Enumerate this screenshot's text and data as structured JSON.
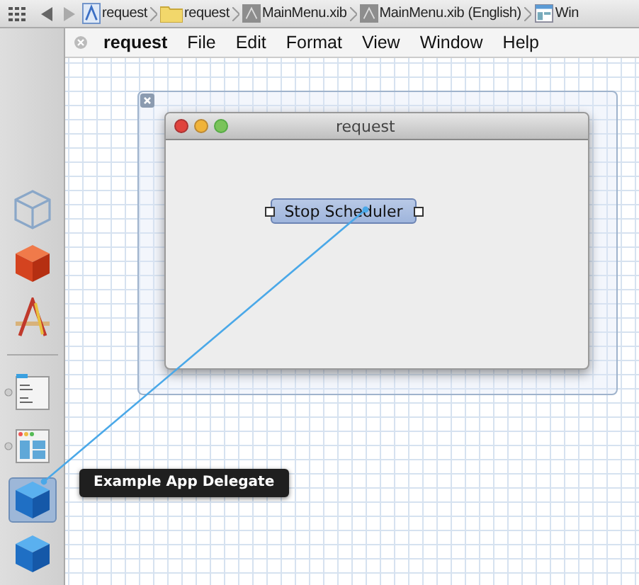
{
  "breadcrumbs": [
    {
      "label": "request",
      "kind": "project"
    },
    {
      "label": "request",
      "kind": "folder"
    },
    {
      "label": "MainMenu.xib",
      "kind": "xib"
    },
    {
      "label": "MainMenu.xib (English)",
      "kind": "xib"
    },
    {
      "label": "Win",
      "kind": "window"
    }
  ],
  "menu_bar": {
    "items": [
      {
        "label": "request",
        "bold": true
      },
      {
        "label": "File",
        "bold": false
      },
      {
        "label": "Edit",
        "bold": false
      },
      {
        "label": "Format",
        "bold": false
      },
      {
        "label": "View",
        "bold": false
      },
      {
        "label": "Window",
        "bold": false
      },
      {
        "label": "Help",
        "bold": false
      }
    ]
  },
  "dock": {
    "groups": [
      {
        "items": [
          {
            "kind": "wire-cube",
            "selected": false,
            "expandable": false
          },
          {
            "kind": "red-cube",
            "selected": false,
            "expandable": false
          },
          {
            "kind": "app-tool",
            "selected": false,
            "expandable": false
          }
        ]
      },
      {
        "items": [
          {
            "kind": "menu",
            "selected": false,
            "expandable": true
          },
          {
            "kind": "window",
            "selected": false,
            "expandable": true
          },
          {
            "kind": "blue-cube",
            "selected": true,
            "expandable": false
          },
          {
            "kind": "blue-cube",
            "selected": false,
            "expandable": false
          }
        ]
      }
    ]
  },
  "tooltip": {
    "label": "Example App Delegate"
  },
  "window": {
    "title": "request",
    "button": "Stop Scheduler"
  }
}
